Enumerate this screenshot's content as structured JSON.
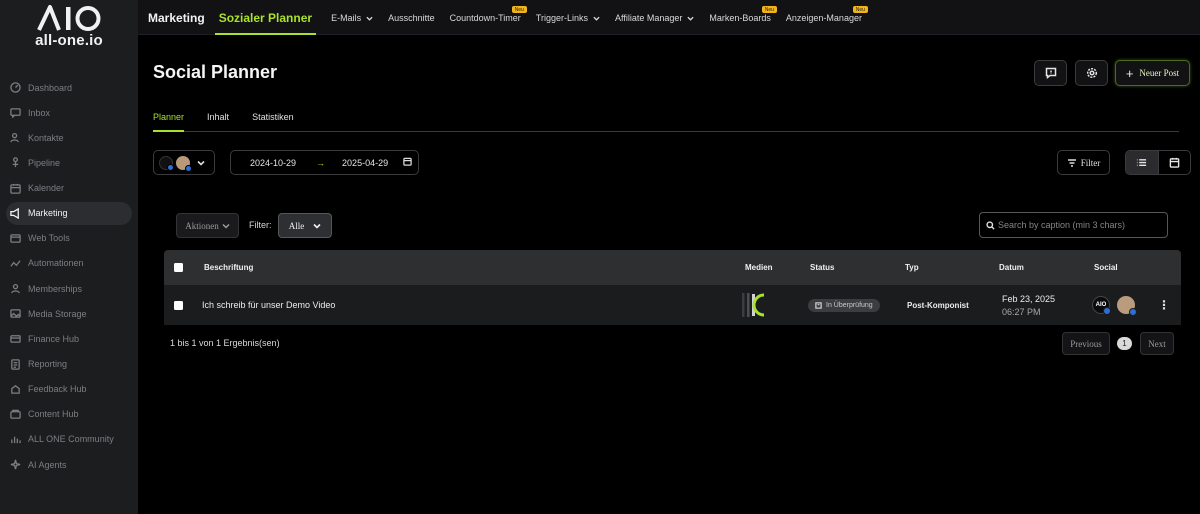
{
  "brand": {
    "logo_text": "all-one.io"
  },
  "sidebar": {
    "items": [
      {
        "label": "Dashboard",
        "icon": "dashboard-icon"
      },
      {
        "label": "Inbox",
        "icon": "inbox-icon"
      },
      {
        "label": "Kontakte",
        "icon": "contacts-icon"
      },
      {
        "label": "Pipeline",
        "icon": "pipeline-icon"
      },
      {
        "label": "Kalender",
        "icon": "calendar-icon"
      },
      {
        "label": "Marketing",
        "icon": "megaphone-icon",
        "active": true
      },
      {
        "label": "Web Tools",
        "icon": "web-icon"
      },
      {
        "label": "Automationen",
        "icon": "automation-icon"
      },
      {
        "label": "Memberships",
        "icon": "members-icon"
      },
      {
        "label": "Media Storage",
        "icon": "image-icon"
      },
      {
        "label": "Finance Hub",
        "icon": "finance-icon"
      },
      {
        "label": "Reporting",
        "icon": "report-icon"
      },
      {
        "label": "Feedback Hub",
        "icon": "feedback-icon"
      },
      {
        "label": "Content Hub",
        "icon": "content-icon"
      },
      {
        "label": "ALL ONE Community",
        "icon": "community-icon"
      },
      {
        "label": "AI Agents",
        "icon": "sparkle-icon"
      }
    ]
  },
  "topnav": {
    "section": "Marketing",
    "items": [
      {
        "label": "Sozialer Planner",
        "active": true
      },
      {
        "label": "E-Mails",
        "dropdown": true
      },
      {
        "label": "Ausschnitte"
      },
      {
        "label": "Countdown-Timer",
        "badge": "Neu"
      },
      {
        "label": "Trigger-Links",
        "dropdown": true
      },
      {
        "label": "Affiliate Manager",
        "dropdown": true
      },
      {
        "label": "Marken-Boards",
        "badge": "Neu"
      },
      {
        "label": "Anzeigen-Manager",
        "badge": "Neu"
      }
    ]
  },
  "page": {
    "title": "Social Planner",
    "new_post_label": "Neuer Post",
    "tabs": [
      "Planner",
      "Inhalt",
      "Statistiken"
    ],
    "date_from": "2024-10-29",
    "date_to": "2025-04-29",
    "filter_label": "Filter"
  },
  "table": {
    "actions_label": "Aktionen",
    "filter_label": "Filter:",
    "filter_value": "Alle",
    "search_placeholder": "Search by caption (min 3 chars)",
    "headers": {
      "caption": "Beschriftung",
      "media": "Medien",
      "status": "Status",
      "type": "Typ",
      "date": "Datum",
      "social": "Social"
    },
    "rows": [
      {
        "caption": "Ich schreib für unser Demo Video",
        "status": "In Überprüfung",
        "type": "Post-Komponist",
        "date": "Feb 23, 2025",
        "time": "06:27 PM",
        "social_logo": "AIO"
      }
    ],
    "results_text": "1 bis 1 von 1 Ergebnis(sen)",
    "prev_label": "Previous",
    "next_label": "Next",
    "current_page": "1"
  },
  "colors": {
    "accent": "#a9e22b",
    "badge": "#f2b519",
    "social_dot": "#2d6fd6"
  }
}
